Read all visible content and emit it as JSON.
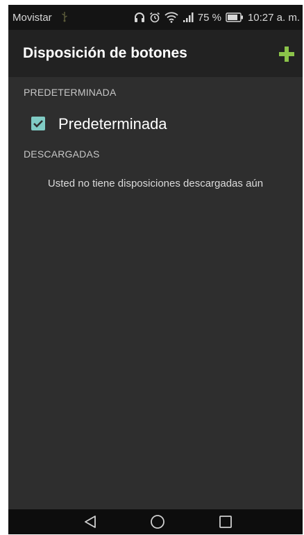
{
  "status_bar": {
    "carrier": "Movistar",
    "battery_percent": "75 %",
    "time": "10:27 a. m.",
    "icons": [
      "usb-icon",
      "headphones-icon",
      "alarm-icon",
      "wifi-icon",
      "signal-icon",
      "battery-icon"
    ]
  },
  "app_bar": {
    "title": "Disposición de botones",
    "add_icon": "plus-icon",
    "accent_color": "#8bc34a"
  },
  "sections": {
    "default_header": "PREDETERMINADA",
    "default_item": {
      "label": "Predeterminada",
      "checked": true,
      "checkbox_color": "#80cbc4"
    },
    "downloaded_header": "DESCARGADAS",
    "downloaded_empty": "Usted no tiene disposiciones descargadas aún"
  },
  "nav_bar": {
    "icons": [
      "back-icon",
      "home-icon",
      "recent-apps-icon"
    ]
  }
}
